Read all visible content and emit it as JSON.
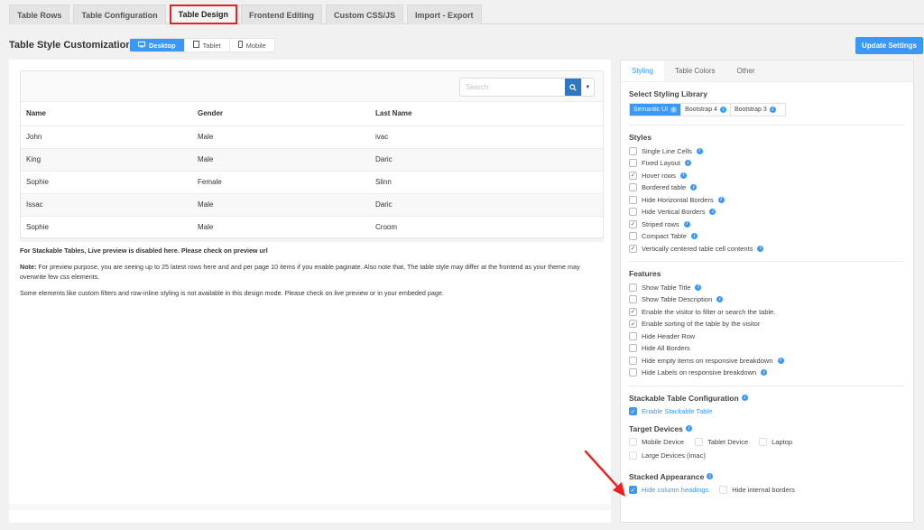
{
  "top_tabs": [
    {
      "label": "Table Rows",
      "active": false
    },
    {
      "label": "Table Configuration",
      "active": false
    },
    {
      "label": "Table Design",
      "active": true
    },
    {
      "label": "Frontend Editing",
      "active": false
    },
    {
      "label": "Custom CSS/JS",
      "active": false
    },
    {
      "label": "Import - Export",
      "active": false
    }
  ],
  "header": {
    "title": "Table Style Customization",
    "devices": [
      {
        "label": "Desktop",
        "icon": "desktop-icon",
        "glyph": "🖵",
        "active": true
      },
      {
        "label": "Tablet",
        "icon": "tablet-icon",
        "glyph": "▯",
        "active": false
      },
      {
        "label": "Mobile",
        "icon": "mobile-icon",
        "glyph": "▯",
        "active": false
      }
    ],
    "update_button": "Update Settings"
  },
  "preview": {
    "search": {
      "placeholder": "Search",
      "value": ""
    },
    "columns": [
      "Name",
      "Gender",
      "Last Name"
    ],
    "rows": [
      [
        "John",
        "Male",
        "ivac"
      ],
      [
        "King",
        "Male",
        "Daric"
      ],
      [
        "Sophie",
        "Female",
        "Slinn"
      ],
      [
        "Issac",
        "Male",
        "Daric"
      ],
      [
        "Sophie",
        "Male",
        "Croom"
      ]
    ],
    "stackable_notice": "For Stackable Tables, Live preview is disabled here. Please check on preview url",
    "note_label": "Note:",
    "note_text": " For preview purpose, you are seeing up to 25 latest rows here and and per page 10 items if you enable paginate. Also note that, The table style may differ at the frontend as your theme may overwrite few css elements.",
    "elements_note": "Some elements like custom filters and row-inline styling is not available in this design mode. Please check on live preview or in your embeded page."
  },
  "settings": {
    "tabs": [
      {
        "label": "Styling",
        "active": true
      },
      {
        "label": "Table Colors",
        "active": false
      },
      {
        "label": "Other",
        "active": false
      }
    ],
    "library": {
      "title": "Select Styling Library",
      "options": [
        {
          "label": "Semantic UI",
          "active": true
        },
        {
          "label": "Bootstrap 4",
          "active": false
        },
        {
          "label": "Bootstrap 3",
          "active": false
        }
      ]
    },
    "styles": {
      "title": "Styles",
      "items": [
        {
          "label": "Single Line Cells",
          "checked": false,
          "info": true
        },
        {
          "label": "Fixed Layout",
          "checked": false,
          "info": true
        },
        {
          "label": "Hover rows",
          "checked": true,
          "info": true
        },
        {
          "label": "Bordered table",
          "checked": false,
          "info": true
        },
        {
          "label": "Hide Horizontal Borders",
          "checked": false,
          "info": true
        },
        {
          "label": "Hide Vertical Borders",
          "checked": false,
          "info": true
        },
        {
          "label": "Striped rows",
          "checked": true,
          "info": true
        },
        {
          "label": "Compact Table",
          "checked": false,
          "info": true
        },
        {
          "label": "Vertically centered table cell contents",
          "checked": true,
          "info": true
        }
      ]
    },
    "features": {
      "title": "Features",
      "items": [
        {
          "label": "Show Table Title",
          "checked": false,
          "info": true
        },
        {
          "label": "Show Table Description",
          "checked": false,
          "info": true
        },
        {
          "label": "Enable the visitor to filter or search the table.",
          "checked": true,
          "info": false
        },
        {
          "label": "Enable sorting of the table by the visitor",
          "checked": true,
          "info": false
        },
        {
          "label": "Hide Header Row",
          "checked": false,
          "info": false
        },
        {
          "label": "Hide All Borders",
          "checked": false,
          "info": false
        },
        {
          "label": "Hide empty items on responsive breakdown",
          "checked": false,
          "info": true
        },
        {
          "label": "Hide Labels on responsive breakdown",
          "checked": false,
          "info": true
        }
      ]
    },
    "stackable": {
      "title": "Stackable Table Configuration",
      "enable_label": "Enable Stackable Table",
      "enabled": true
    },
    "target_devices": {
      "title": "Target Devices",
      "items": [
        {
          "label": "Mobile Device",
          "checked": false
        },
        {
          "label": "Tablet Device",
          "checked": false
        },
        {
          "label": "Laptop",
          "checked": false
        },
        {
          "label": "Large Devices (imac)",
          "checked": false
        }
      ]
    },
    "stacked_appearance": {
      "title": "Stacked Appearance",
      "items": [
        {
          "label": "Hide column headings",
          "checked": true
        },
        {
          "label": "Hide internal borders",
          "checked": false
        }
      ]
    }
  },
  "colors": {
    "accent": "#3b98f5",
    "search_button": "#2f78bf",
    "highlight_border": "#e02424",
    "annotation_arrow": "#f01e1e"
  }
}
